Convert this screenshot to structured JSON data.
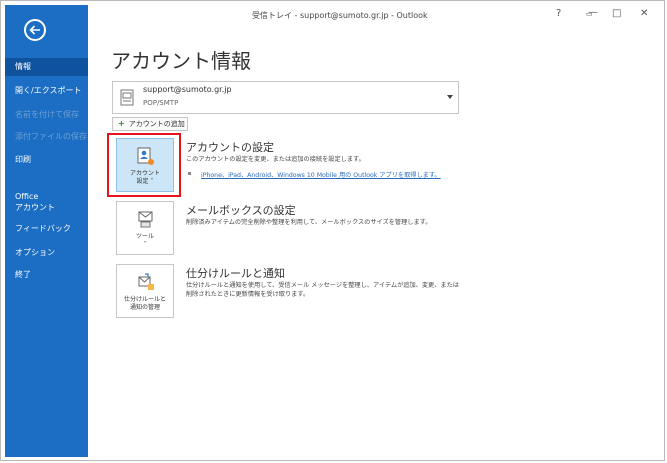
{
  "window": {
    "title": "受信トレイ - support@sumoto.gr.jp  -  Outlook",
    "help": "?",
    "minimize": "—",
    "restore": "□",
    "close": "✕"
  },
  "sidebar": {
    "items": [
      {
        "label": "情報"
      },
      {
        "label": "開く/エクスポート"
      },
      {
        "label": "名前を付けて保存"
      },
      {
        "label": "添付ファイルの保存"
      },
      {
        "label": "印刷"
      },
      {
        "label": "Office"
      },
      {
        "label": "アカウント"
      },
      {
        "label": "フィードバック"
      },
      {
        "label": "オプション"
      },
      {
        "label": "終了"
      }
    ]
  },
  "main": {
    "title": "アカウント情報",
    "account": {
      "email": "support@sumoto.gr.jp",
      "type": "POP/SMTP"
    },
    "add_account": "アカウントの追加",
    "sections": [
      {
        "button_line1": "アカウント",
        "button_line2": "設定 ˅",
        "title": "アカウントの設定",
        "desc": "このアカウントの設定を変更、または追加の接続を設定します。",
        "link": "iPhone、iPad、Android、Windows 10 Mobile 用の Outlook アプリを取得します。"
      },
      {
        "button_line1": "ツール",
        "button_line2": "˅",
        "title": "メールボックスの設定",
        "desc": "削除済みアイテムの完全削除や整理を利用して、メールボックスのサイズを管理します。"
      },
      {
        "button_line1": "仕分けルールと",
        "button_line2": "通知の管理",
        "title": "仕分けルールと通知",
        "desc_line1": "仕分けルールと通知を使用して、受信メール メッセージを整理し、アイテムが追加、変更、または",
        "desc_line2": "削除されたときに更新情報を受け取ります。"
      }
    ]
  }
}
